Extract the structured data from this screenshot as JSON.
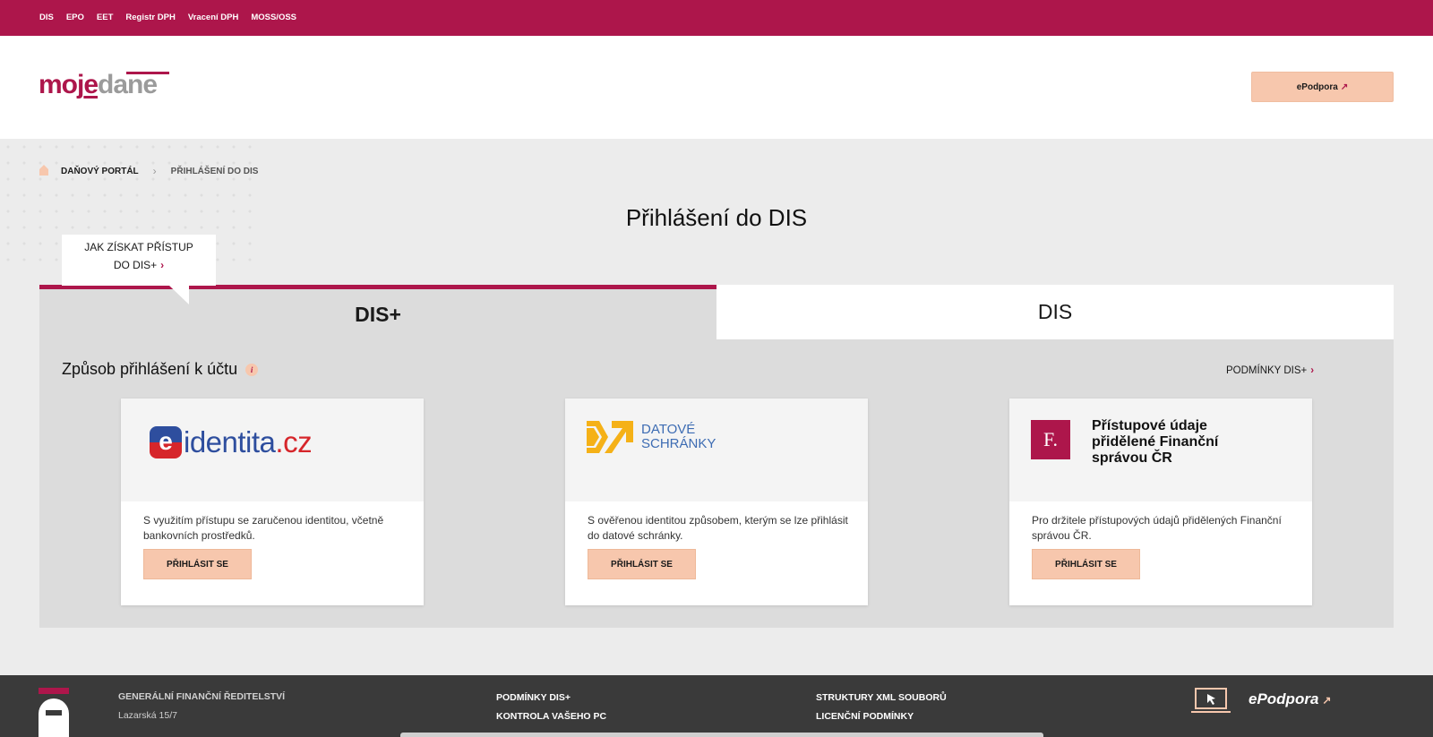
{
  "topbar": {
    "items": [
      "DIS",
      "EPO",
      "EET",
      "Registr DPH",
      "Vracení DPH",
      "MOSS/OSS"
    ]
  },
  "header": {
    "logo": {
      "part1": "moj",
      "part2": "e",
      "part3": "dane"
    },
    "epodpora_label": "ePodpora",
    "external_icon": "arrow-up-right-icon"
  },
  "breadcrumb": {
    "home_icon": "home-icon",
    "items": [
      "DAŇOVÝ PORTÁL",
      "PŘIHLÁŠENÍ DO DIS"
    ],
    "separator": "›"
  },
  "page": {
    "title": "Přihlášení do DIS"
  },
  "howto": {
    "line1": "JAK ZÍSKAT PŘÍSTUP",
    "line2": "DO DIS+",
    "chevron": "›"
  },
  "tabs": [
    {
      "label": "DIS+",
      "active": true
    },
    {
      "label": "DIS",
      "active": false
    }
  ],
  "login": {
    "heading": "Způsob přihlášení k účtu",
    "info_glyph": "i",
    "conditions_link": "PODMÍNKY DIS+",
    "chevron": "›",
    "cards": [
      {
        "logo": {
          "e": "e",
          "main": "identita",
          "tld": ".cz"
        },
        "description": "S využitím přístupu se zaručenou identitou, včetně bankovních prostředků.",
        "button": "PŘIHLÁSIT SE"
      },
      {
        "logo": {
          "line1": "DATOVÉ",
          "line2": "SCHRÁNKY"
        },
        "description": "S ověřenou identitou způsobem, kterým se lze přihlásit do datové schránky.",
        "button": "PŘIHLÁSIT SE"
      },
      {
        "logo": {
          "letter": "F.",
          "title": "Přístupové údaje přidělené Finanční správou ČR"
        },
        "description": "Pro držitele přístupových údajů přidělených Finanční správou ČR.",
        "button": "PŘIHLÁSIT SE"
      }
    ]
  },
  "footer": {
    "org_name": "GENERÁLNÍ FINANČNÍ ŘEDITELSTVÍ",
    "address": "Lazarská 15/7",
    "col2": [
      "PODMÍNKY DIS+",
      "KONTROLA VAŠEHO PC"
    ],
    "col3": [
      "STRUKTURY XML SOUBORŮ",
      "LICENČNÍ PODMÍNKY"
    ],
    "epodpora_label": "ePodpora",
    "laptop_icon": "laptop-cursor-icon"
  },
  "colors": {
    "brand": "#ad164b",
    "accent": "#f7c7ad",
    "panel": "#dcdcdc",
    "footer": "#3a3a3a"
  }
}
